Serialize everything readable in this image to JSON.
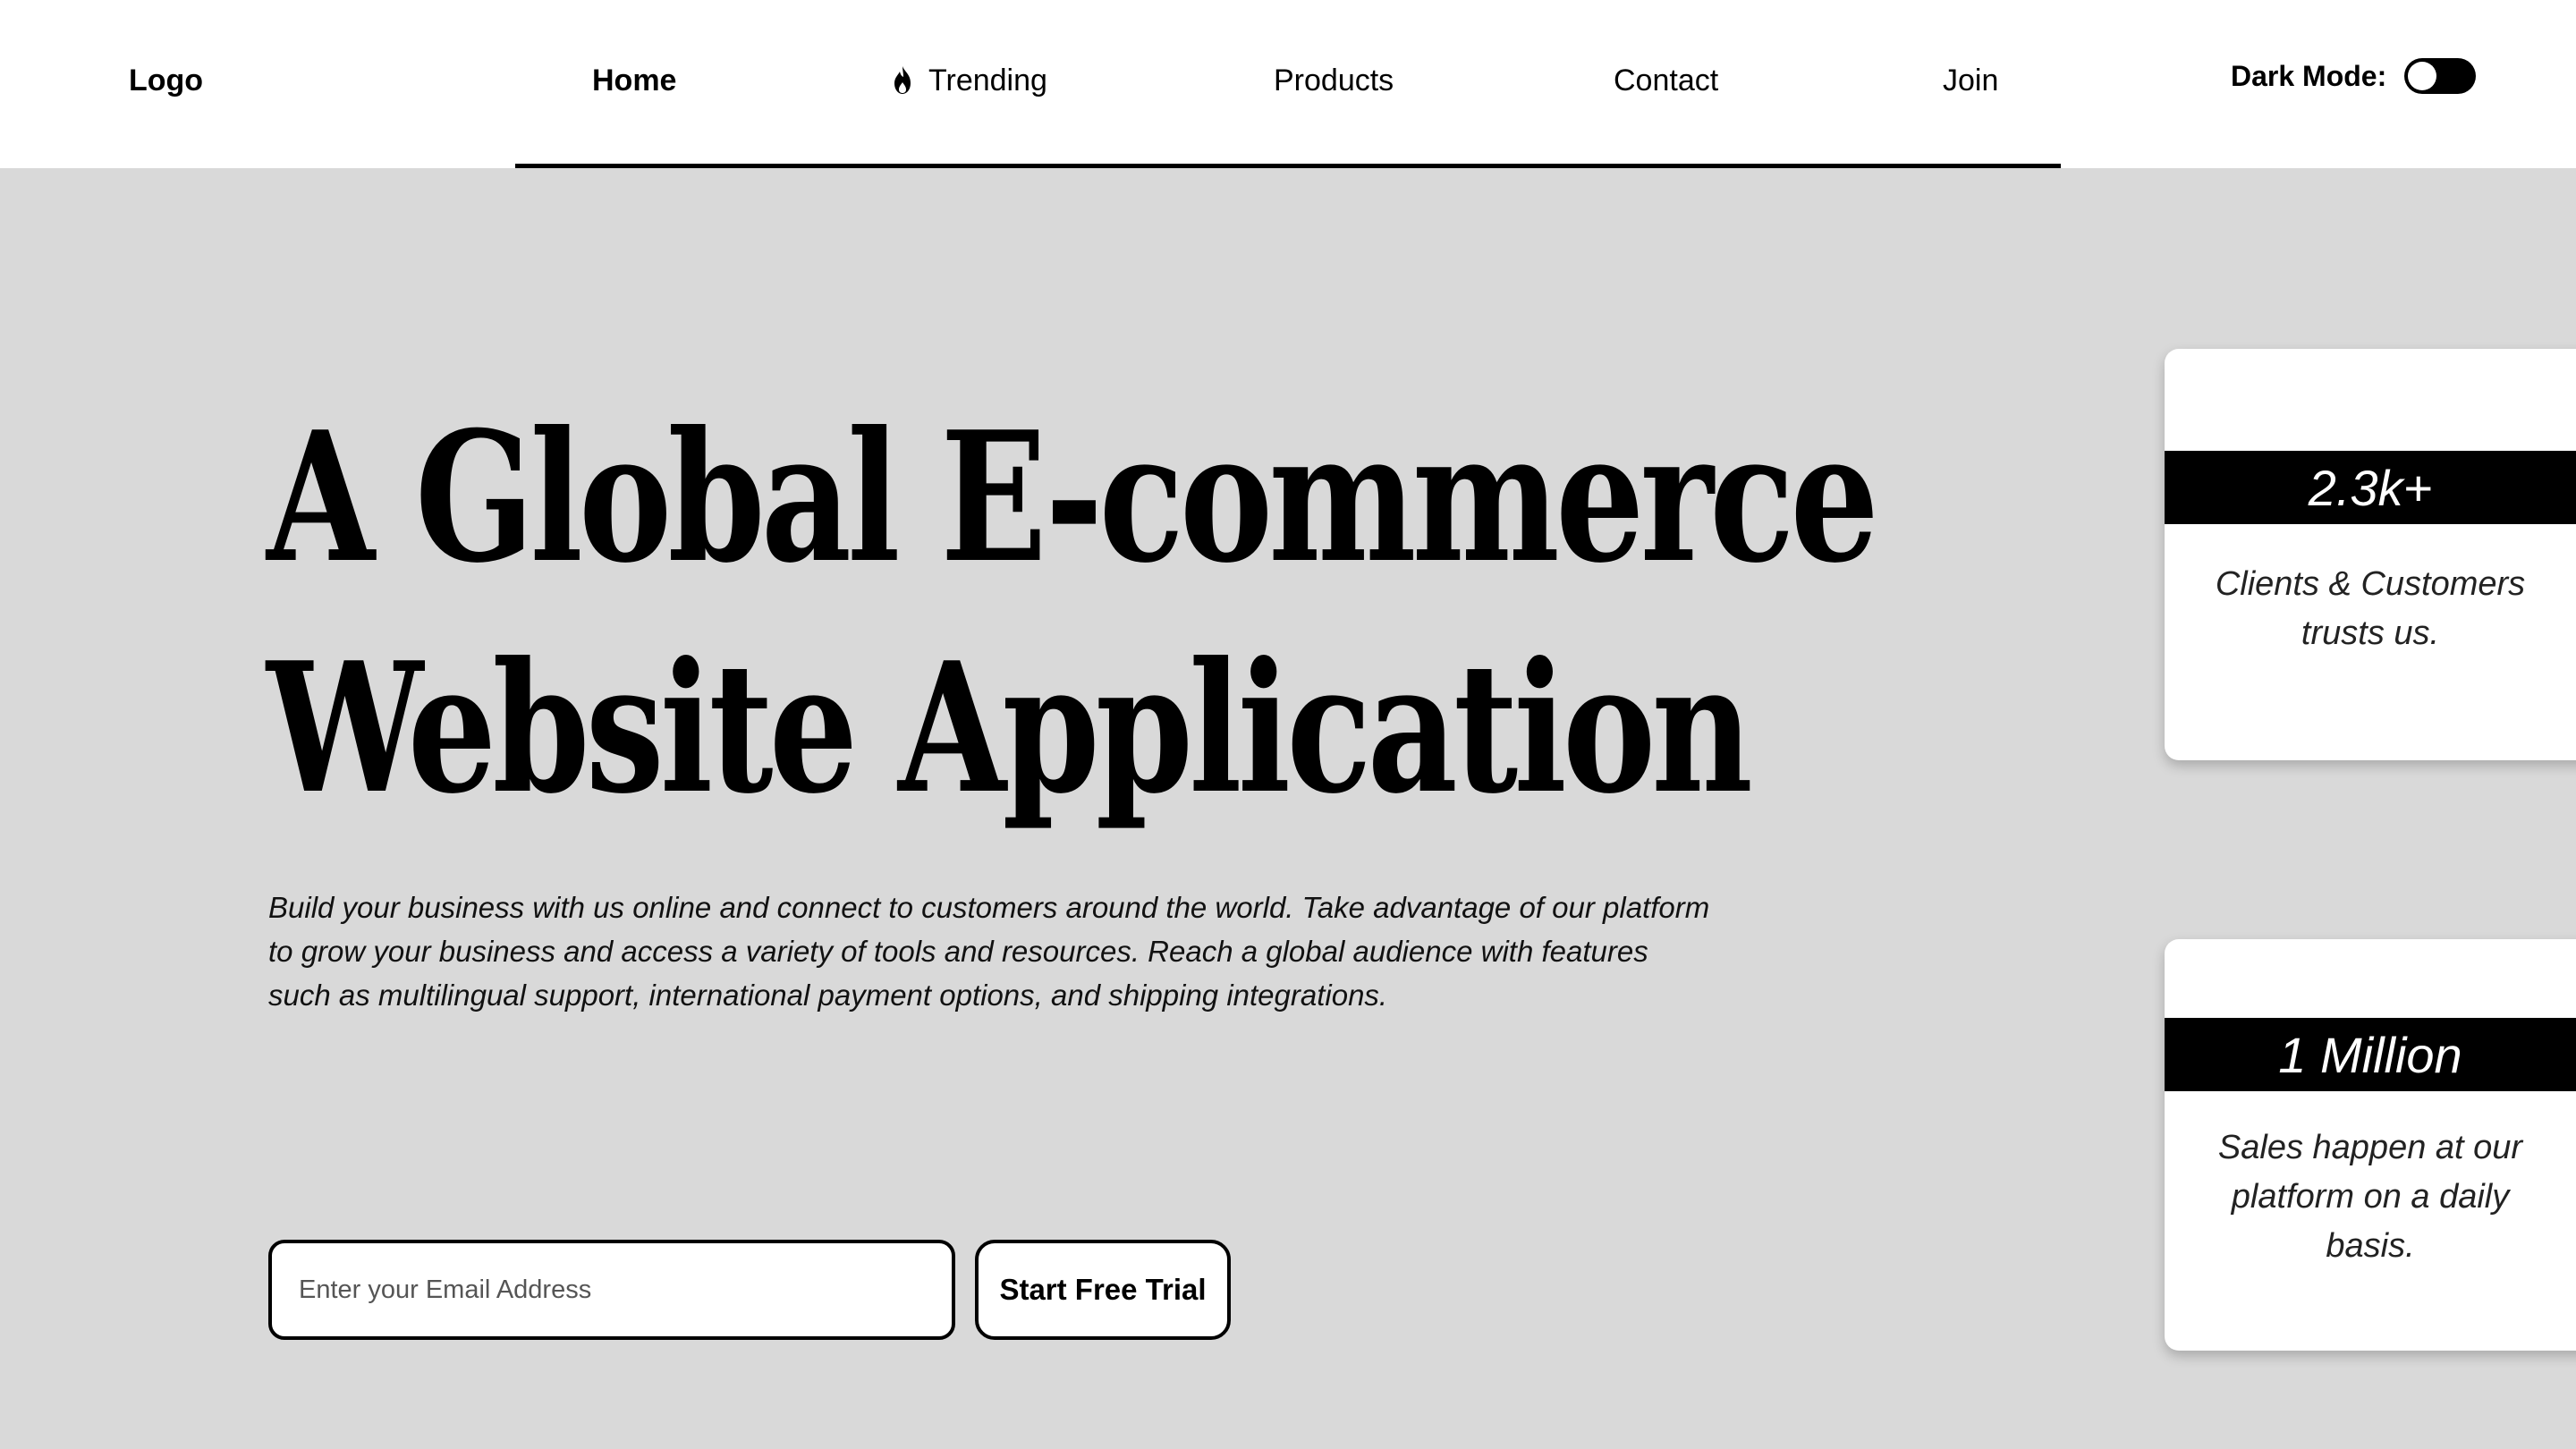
{
  "header": {
    "logo": "Logo",
    "nav": [
      {
        "label": "Home",
        "active": true
      },
      {
        "label": "Trending",
        "icon": "fire-icon"
      },
      {
        "label": "Products"
      },
      {
        "label": "Contact"
      },
      {
        "label": "Join"
      }
    ],
    "dark_mode": {
      "label": "Dark Mode:",
      "enabled": false
    }
  },
  "hero": {
    "title_line1": "A Global E-commerce",
    "title_line2": "Website Application",
    "description": "Build your business with us online and connect to customers around the world. Take advantage of our platform to grow your business and access a variety of tools and resources. Reach a global audience with features such as multilingual support, international payment options, and shipping integrations.",
    "email_placeholder": "Enter your Email Address",
    "email_value": "",
    "cta_label": "Start Free Trial"
  },
  "stats": [
    {
      "value": "2.3k+",
      "text": "Clients & Customers trusts us."
    },
    {
      "value": "1 Million",
      "text": "Sales happen at our platform on a daily basis."
    }
  ],
  "colors": {
    "background": "#d9d9d9",
    "header_bg": "#ffffff",
    "accent": "#000000"
  }
}
